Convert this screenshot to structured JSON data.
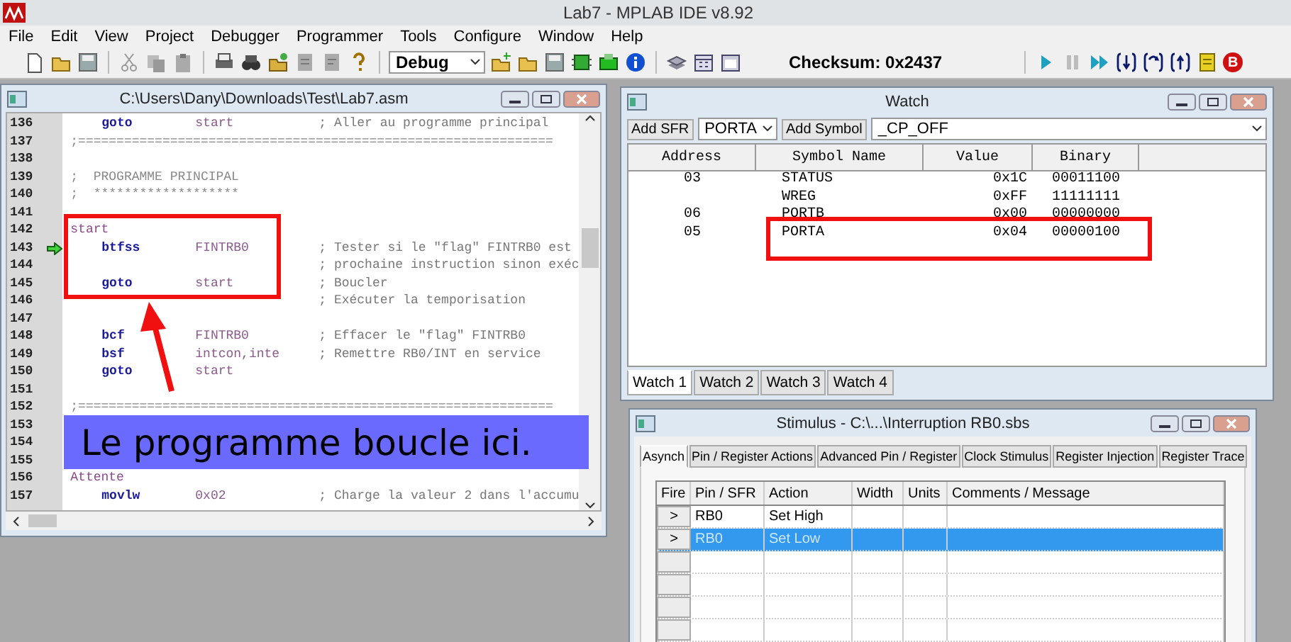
{
  "app": {
    "title": "Lab7 - MPLAB IDE v8.92"
  },
  "menu": [
    "File",
    "Edit",
    "View",
    "Project",
    "Debugger",
    "Programmer",
    "Tools",
    "Configure",
    "Window",
    "Help"
  ],
  "toolbar": {
    "configuration": "Debug",
    "checksum": "Checksum:  0x2437",
    "breakpoint_badge": "B"
  },
  "editor": {
    "title": "C:\\Users\\Dany\\Downloads\\Test\\Lab7.asm",
    "lines": [
      {
        "number": "136",
        "kind": "code",
        "op": "goto",
        "operand": "start",
        "comment": "; Aller au programme principal",
        "current": false
      },
      {
        "number": "137",
        "kind": "note",
        "text": ";==============================================================",
        "current": false
      },
      {
        "number": "138",
        "kind": "blank",
        "current": false
      },
      {
        "number": "139",
        "kind": "note",
        "text": ";  PROGRAMME PRINCIPAL",
        "current": false
      },
      {
        "number": "140",
        "kind": "note",
        "text": ";  *******************",
        "current": false
      },
      {
        "number": "141",
        "kind": "blank",
        "current": false
      },
      {
        "number": "142",
        "kind": "label",
        "text": "start",
        "current": false
      },
      {
        "number": "143",
        "kind": "code",
        "op": "btfss",
        "operand": "FINTRB0",
        "comment": "; Tester si le \"flag\" FINTRB0 est",
        "current": true
      },
      {
        "number": "144",
        "kind": "code",
        "comment": "; prochaine instruction sinon exéc",
        "current": false
      },
      {
        "number": "145",
        "kind": "code",
        "op": "goto",
        "operand": "start",
        "comment": "; Boucler",
        "current": false
      },
      {
        "number": "146",
        "kind": "code",
        "comment": "; Exécuter la temporisation",
        "current": false
      },
      {
        "number": "147",
        "kind": "blank",
        "current": false
      },
      {
        "number": "148",
        "kind": "code",
        "op": "bcf",
        "operand": "FINTRB0",
        "comment": "; Effacer le \"flag\" FINTRB0",
        "current": false
      },
      {
        "number": "149",
        "kind": "code",
        "op": "bsf",
        "operand": "intcon,inte",
        "comment": "; Remettre RB0/INT en service",
        "current": false
      },
      {
        "number": "150",
        "kind": "code",
        "op": "goto",
        "operand": "start",
        "current": false
      },
      {
        "number": "151",
        "kind": "blank",
        "current": false
      },
      {
        "number": "152",
        "kind": "note",
        "text": ";==============================================================",
        "current": false
      },
      {
        "number": "153",
        "kind": "blank",
        "current": false
      },
      {
        "number": "154",
        "kind": "blank",
        "current": false
      },
      {
        "number": "155",
        "kind": "blank",
        "current": false
      },
      {
        "number": "156",
        "kind": "label",
        "text": "Attente",
        "current": false
      },
      {
        "number": "157",
        "kind": "code",
        "op": "movlw",
        "operand": "0x02",
        "comment": "; Charge la valeur 2 dans l'accumu",
        "current": false
      }
    ]
  },
  "watch": {
    "title": "Watch",
    "add_sfr_button": "Add SFR",
    "sfr_value": "PORTA",
    "add_symbol_button": "Add Symbol",
    "symbol_value": "_CP_OFF",
    "columns": [
      "Address",
      "Symbol Name",
      "Value",
      "Binary"
    ],
    "rows": [
      {
        "address": "03",
        "symbol": "STATUS",
        "value": "0x1C",
        "binary": "00011100"
      },
      {
        "address": "",
        "symbol": "WREG",
        "value": "0xFF",
        "binary": "11111111"
      },
      {
        "address": "06",
        "symbol": "PORTB",
        "value": "0x00",
        "binary": "00000000"
      },
      {
        "address": "05",
        "symbol": "PORTA",
        "value": "0x04",
        "binary": "00000100"
      }
    ],
    "tabs": [
      {
        "label": "Watch 1",
        "selected": true
      },
      {
        "label": "Watch 2",
        "selected": false
      },
      {
        "label": "Watch 3",
        "selected": false
      },
      {
        "label": "Watch 4",
        "selected": false
      }
    ]
  },
  "stimulus": {
    "title": "Stimulus - C:\\...\\Interruption RB0.sbs",
    "tabs": [
      {
        "label": "Asynch",
        "selected": true
      },
      {
        "label": "Pin / Register Actions",
        "selected": false
      },
      {
        "label": "Advanced Pin / Register",
        "selected": false
      },
      {
        "label": "Clock Stimulus",
        "selected": false
      },
      {
        "label": "Register Injection",
        "selected": false
      },
      {
        "label": "Register Trace",
        "selected": false
      }
    ],
    "columns": [
      "Fire",
      "Pin / SFR",
      "Action",
      "Width",
      "Units",
      "Comments / Message"
    ],
    "rows": [
      {
        "fire": ">",
        "pin": "RB0",
        "action": "Set High",
        "selected": false
      },
      {
        "fire": ">",
        "pin": "RB0",
        "action": "Set Low",
        "selected": true
      }
    ]
  },
  "annotation": {
    "callout": "Le programme boucle ici."
  }
}
